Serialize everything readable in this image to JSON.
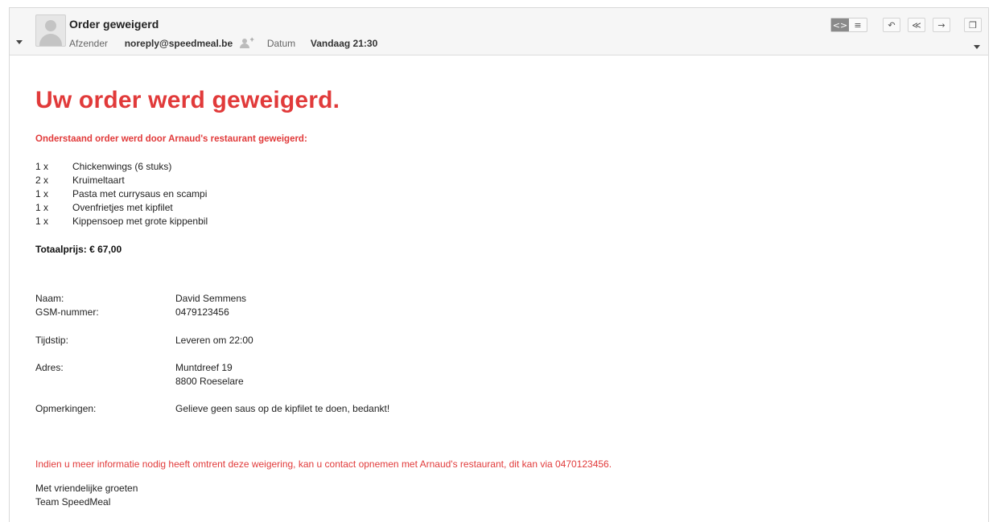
{
  "header": {
    "subject": "Order geweigerd",
    "sender_label": "Afzender",
    "sender": "noreply@speedmeal.be",
    "date_label": "Datum",
    "date": "Vandaag 21:30"
  },
  "toolbar": {
    "view_icons": [
      "code-view-icon",
      "text-view-icon"
    ],
    "action_icons": [
      "reply-icon",
      "reply-all-icon",
      "forward-icon",
      "new-window-icon"
    ]
  },
  "body": {
    "headline": "Uw order werd geweigerd.",
    "intro": "Onderstaand order werd door Arnaud's restaurant geweigerd:",
    "items": [
      {
        "qty": "1 x",
        "name": "Chickenwings (6 stuks)"
      },
      {
        "qty": "2 x",
        "name": "Kruimeltaart"
      },
      {
        "qty": "1 x",
        "name": "Pasta met currysaus en scampi"
      },
      {
        "qty": "1 x",
        "name": "Ovenfrietjes met kipfilet"
      },
      {
        "qty": "1 x",
        "name": "Kippensoep met grote kippenbil"
      }
    ],
    "total": "Totaalprijs: € 67,00",
    "details": {
      "name_label": "Naam:",
      "name": "David Semmens",
      "phone_label": "GSM-nummer:",
      "phone": "0479123456",
      "time_label": "Tijdstip:",
      "time": "Leveren om 22:00",
      "address_label": "Adres:",
      "address_line1": "Muntdreef 19",
      "address_line2": "8800 Roeselare",
      "remarks_label": "Opmerkingen:",
      "remarks": "Gelieve geen saus op de kipfilet te doen, bedankt!"
    },
    "info": "Indien u meer informatie nodig heeft omtrent deze weigering, kan u contact opnemen met Arnaud's restaurant, dit kan via 0470123456.",
    "closing_line1": "Met vriendelijke groeten",
    "closing_line2": "Team SpeedMeal"
  },
  "colors": {
    "accent_red": "#e13a3a",
    "header_bg": "#f6f6f6"
  }
}
